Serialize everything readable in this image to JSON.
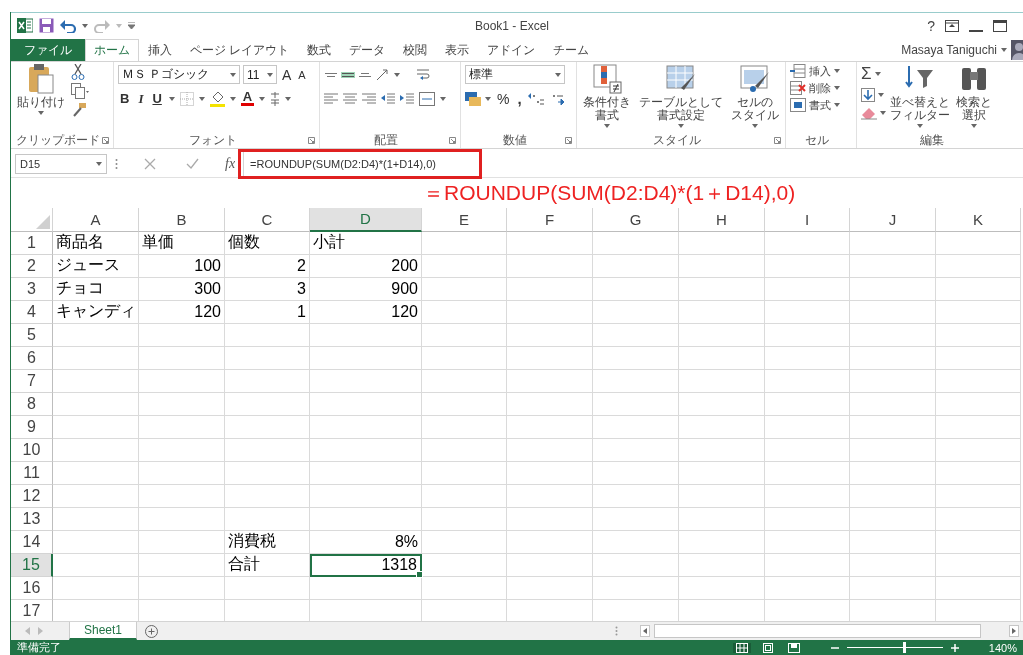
{
  "title_bar": {
    "title": "Book1 - Excel",
    "help": "?"
  },
  "tabs": [
    {
      "label": "ファイル",
      "kind": "file",
      "selected": false
    },
    {
      "label": "ホーム",
      "kind": "tab",
      "selected": true
    },
    {
      "label": "挿入",
      "kind": "tab",
      "selected": false
    },
    {
      "label": "ページ レイアウト",
      "kind": "tab",
      "selected": false
    },
    {
      "label": "数式",
      "kind": "tab",
      "selected": false
    },
    {
      "label": "データ",
      "kind": "tab",
      "selected": false
    },
    {
      "label": "校閲",
      "kind": "tab",
      "selected": false
    },
    {
      "label": "表示",
      "kind": "tab",
      "selected": false
    },
    {
      "label": "アドイン",
      "kind": "tab",
      "selected": false
    },
    {
      "label": "チーム",
      "kind": "tab",
      "selected": false
    }
  ],
  "account": {
    "name": "Masaya Taniguchi"
  },
  "ribbon": {
    "clipboard": {
      "paste": "貼り付け",
      "label": "クリップボード"
    },
    "font": {
      "name": "ＭＳ Ｐゴシック",
      "size": "11",
      "grow": "A",
      "shrink": "A",
      "bold": "B",
      "italic": "I",
      "underline": "U",
      "color_glyph": "A",
      "label": "フォント"
    },
    "alignment": {
      "vertical": [
        {
          "kind": "top",
          "selected": false
        },
        {
          "kind": "middle",
          "selected": true
        },
        {
          "kind": "bottom",
          "selected": false
        }
      ],
      "label": "配置"
    },
    "number": {
      "format": "標準",
      "percent": "%",
      "comma": ",",
      "label": "数値"
    },
    "styles": {
      "buttons": [
        {
          "kind": "conditional",
          "lines": [
            "条件付き",
            "書式"
          ]
        },
        {
          "kind": "table",
          "lines": [
            "テーブルとして",
            "書式設定"
          ]
        },
        {
          "kind": "cell",
          "lines": [
            "セルの",
            "スタイル"
          ]
        }
      ],
      "label": "スタイル"
    },
    "cells": {
      "buttons": [
        {
          "kind": "insert",
          "label": "挿入"
        },
        {
          "kind": "delete",
          "label": "削除"
        },
        {
          "kind": "format",
          "label": "書式"
        }
      ],
      "label": "セル"
    },
    "editing": {
      "sum": "Σ",
      "buttons": [
        {
          "kind": "sort",
          "lines": [
            "並べ替えと",
            "フィルター"
          ]
        },
        {
          "kind": "find",
          "lines": [
            "検索と",
            "選択"
          ]
        }
      ],
      "label": "編集"
    }
  },
  "formula_bar": {
    "name_box": "D15",
    "fx": "fx",
    "formula": "=ROUNDUP(SUM(D2:D4)*(1+D14),0)"
  },
  "annotation": "＝ROUNDUP(SUM(D2:D4)*(1＋D14),0)",
  "grid": {
    "columns": [
      {
        "label": "A",
        "selected": false
      },
      {
        "label": "B",
        "selected": false
      },
      {
        "label": "C",
        "selected": false
      },
      {
        "label": "D",
        "selected": true
      },
      {
        "label": "E",
        "selected": false
      },
      {
        "label": "F",
        "selected": false
      },
      {
        "label": "G",
        "selected": false
      },
      {
        "label": "H",
        "selected": false
      },
      {
        "label": "I",
        "selected": false
      },
      {
        "label": "J",
        "selected": false
      },
      {
        "label": "K",
        "selected": false
      }
    ],
    "rows": [
      {
        "label": "1",
        "selected": false,
        "cells": {
          "a": {
            "text": "商品名",
            "kind": "text",
            "selected": false
          },
          "b": {
            "text": "単価",
            "kind": "text",
            "selected": false
          },
          "c": {
            "text": "個数",
            "kind": "text",
            "selected": false
          },
          "d": {
            "text": "小計",
            "kind": "text",
            "selected": false
          }
        }
      },
      {
        "label": "2",
        "selected": false,
        "cells": {
          "a": {
            "text": "ジュース",
            "kind": "text",
            "selected": false
          },
          "b": {
            "text": "100",
            "kind": "number",
            "selected": false
          },
          "c": {
            "text": "2",
            "kind": "number",
            "selected": false
          },
          "d": {
            "text": "200",
            "kind": "number",
            "selected": false
          }
        }
      },
      {
        "label": "3",
        "selected": false,
        "cells": {
          "a": {
            "text": "チョコ",
            "kind": "text",
            "selected": false
          },
          "b": {
            "text": "300",
            "kind": "number",
            "selected": false
          },
          "c": {
            "text": "3",
            "kind": "number",
            "selected": false
          },
          "d": {
            "text": "900",
            "kind": "number",
            "selected": false
          }
        }
      },
      {
        "label": "4",
        "selected": false,
        "cells": {
          "a": {
            "text": "キャンディ",
            "kind": "text",
            "selected": false
          },
          "b": {
            "text": "120",
            "kind": "number",
            "selected": false
          },
          "c": {
            "text": "1",
            "kind": "number",
            "selected": false
          },
          "d": {
            "text": "120",
            "kind": "number",
            "selected": false
          }
        }
      },
      {
        "label": "5",
        "selected": false,
        "cells": {}
      },
      {
        "label": "6",
        "selected": false,
        "cells": {}
      },
      {
        "label": "7",
        "selected": false,
        "cells": {}
      },
      {
        "label": "8",
        "selected": false,
        "cells": {}
      },
      {
        "label": "9",
        "selected": false,
        "cells": {}
      },
      {
        "label": "10",
        "selected": false,
        "cells": {}
      },
      {
        "label": "11",
        "selected": false,
        "cells": {}
      },
      {
        "label": "12",
        "selected": false,
        "cells": {}
      },
      {
        "label": "13",
        "selected": false,
        "cells": {}
      },
      {
        "label": "14",
        "selected": false,
        "cells": {
          "c": {
            "text": "消費税",
            "kind": "text",
            "selected": false
          },
          "d": {
            "text": "8%",
            "kind": "number",
            "selected": false
          }
        }
      },
      {
        "label": "15",
        "selected": true,
        "cells": {
          "c": {
            "text": "合計",
            "kind": "text",
            "selected": false
          },
          "d": {
            "text": "1318",
            "kind": "number",
            "selected": true
          }
        }
      },
      {
        "label": "16",
        "selected": false,
        "cells": {}
      },
      {
        "label": "17",
        "selected": false,
        "cells": {}
      }
    ]
  },
  "sheet_tabs": [
    {
      "label": "Sheet1",
      "selected": true
    }
  ],
  "status_bar": {
    "status": "準備完了",
    "views": [
      {
        "kind": "normal",
        "selected": true
      },
      {
        "kind": "page_layout",
        "selected": false
      },
      {
        "kind": "page_break",
        "selected": false
      }
    ],
    "zoom_slider": {
      "level": 0.6
    },
    "zoom": "140%"
  }
}
